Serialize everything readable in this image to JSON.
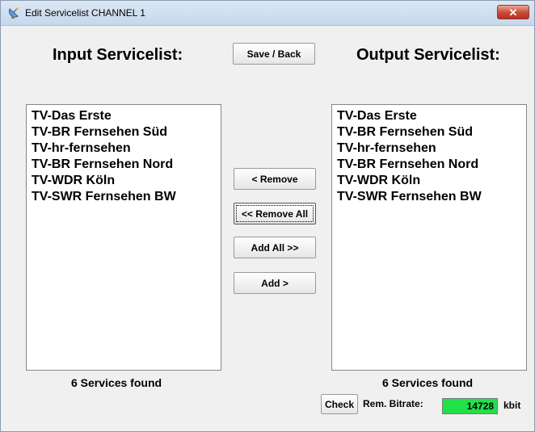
{
  "window": {
    "title": "Edit Servicelist CHANNEL 1",
    "close_label": "✕"
  },
  "input": {
    "heading": "Input Servicelist:",
    "items": [
      "TV-Das Erste",
      "TV-BR Fernsehen Süd",
      "TV-hr-fernsehen",
      "TV-BR Fernsehen Nord",
      "TV-WDR Köln",
      "TV-SWR Fernsehen BW"
    ],
    "found_text": "6 Services found"
  },
  "output": {
    "heading": "Output Servicelist:",
    "items": [
      "TV-Das Erste",
      "TV-BR Fernsehen Süd",
      "TV-hr-fernsehen",
      "TV-BR Fernsehen Nord",
      "TV-WDR Köln",
      "TV-SWR Fernsehen BW"
    ],
    "found_text": "6 Services found"
  },
  "buttons": {
    "save_back": "Save / Back",
    "remove": "< Remove",
    "remove_all": "<< Remove All",
    "add_all": "Add All >>",
    "add": "Add >",
    "check": "Check"
  },
  "bitrate": {
    "label": "Rem. Bitrate:",
    "value": "14728",
    "unit": "kbit",
    "color": "#22e04a"
  },
  "icons": {
    "app": "satellite-dish-icon",
    "close": "close-icon"
  }
}
